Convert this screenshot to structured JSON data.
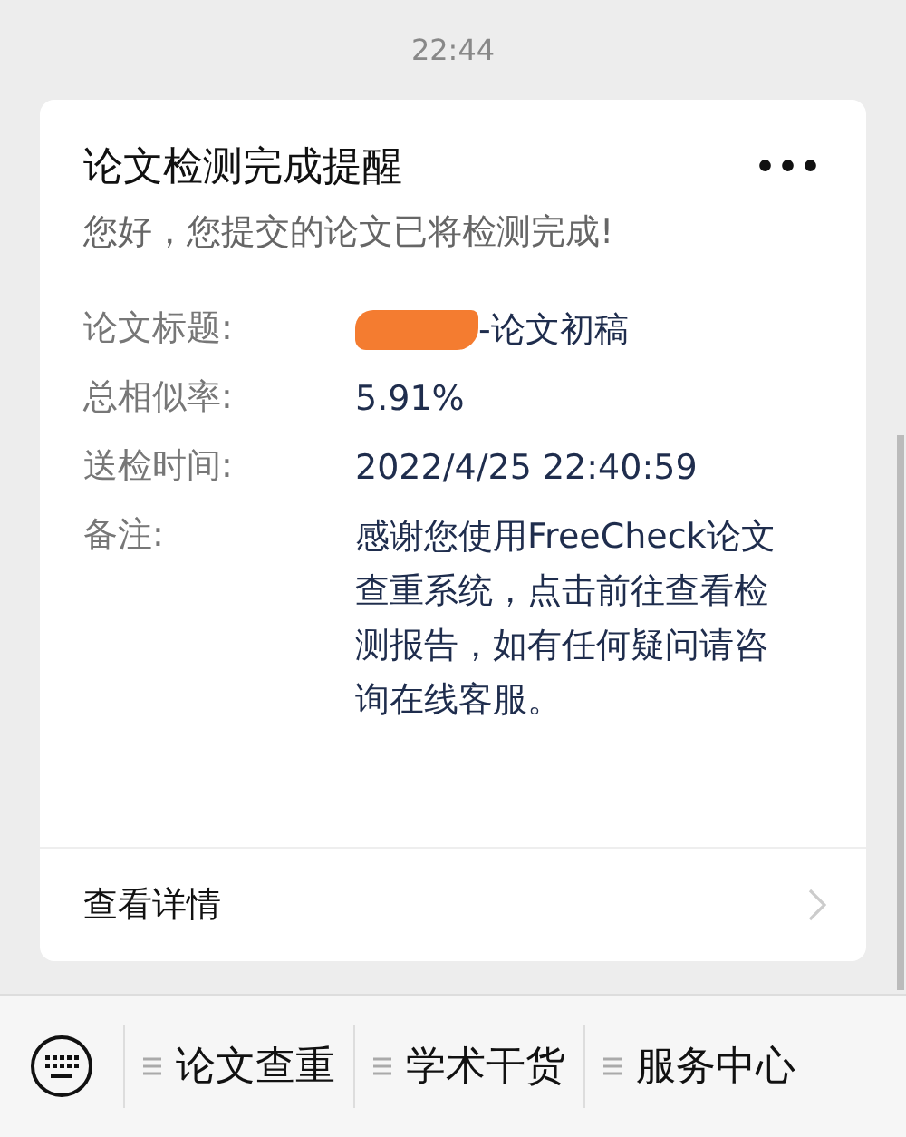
{
  "time": "22:44",
  "card": {
    "title": "论文检测完成提醒",
    "menu_icon": "•••",
    "subtitle": "您好，您提交的论文已将检测完成!",
    "fields": [
      {
        "label": "论文标题:",
        "value": "-论文初稿",
        "redacted": true
      },
      {
        "label": "总相似率:",
        "value": "5.91%",
        "redacted": false
      },
      {
        "label": "送检时间:",
        "value": "2022/4/25 22:40:59",
        "redacted": false
      },
      {
        "label": "备注:",
        "value": "感谢您使用FreeCheck论文查重系统，点击前往查看检测报告，如有任何疑问请咨询在线客服。",
        "redacted": false
      }
    ],
    "footer_link": "查看详情"
  },
  "menu_bar": {
    "items": [
      "论文查重",
      "学术干货",
      "服务中心"
    ]
  }
}
